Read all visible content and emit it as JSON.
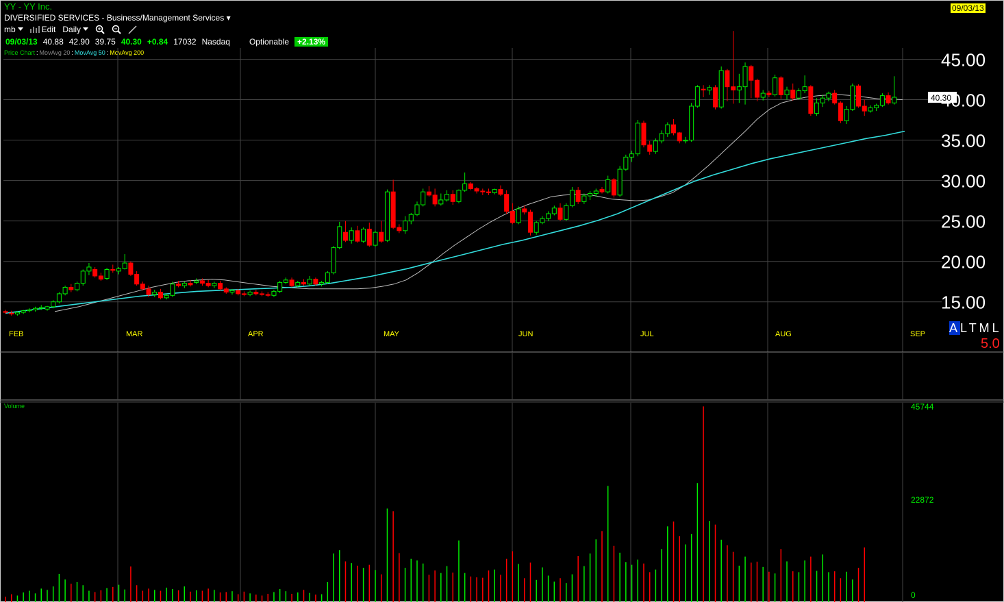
{
  "header": {
    "title": "YY - YY Inc.",
    "date_badge": "09/03/13",
    "sector": "DIVERSIFIED SERVICES - Business/Management Services",
    "sector_arrow": "▾",
    "toolbar": {
      "list": "mb",
      "edit": "Edit",
      "period": "Daily"
    }
  },
  "quote": {
    "date": "09/03/13",
    "open": "40.88",
    "high": "42.90",
    "low": "39.75",
    "close": "40.30",
    "change": "+0.84",
    "volume": "17032",
    "exchange": "Nasdaq",
    "optionable": "Optionable",
    "pct_change": "+2.13%"
  },
  "legend": {
    "price": "Price Chart",
    "ma20": "MovAvg 20",
    "ma50": "MovAvg 50",
    "ma200": "MovAvg 200",
    "sep": ":"
  },
  "colors": {
    "up": "#00ee00",
    "down": "#ff0000",
    "ma20": "#bbbbbb",
    "ma50": "#33dddd",
    "ma200": "#ffff00",
    "grid": "#444444"
  },
  "panel": {
    "altml": "ALTML",
    "five": "5.0"
  },
  "chart_data": [
    {
      "type": "candlestick",
      "title": "",
      "y_ticks": [
        "15.00",
        "20.00",
        "25.00",
        "30.00",
        "35.00",
        "40.00",
        "45.00"
      ],
      "ylim": [
        12.8,
        48.5
      ],
      "x_ticks": [
        "FEB",
        "MAR",
        "APR",
        "MAY",
        "JUN",
        "JUL",
        "AUG",
        "SEP"
      ],
      "last_price_label": "40.30",
      "candles": [
        [
          13.8,
          14.0,
          13.5,
          13.7
        ],
        [
          13.6,
          13.9,
          13.3,
          13.5
        ],
        [
          13.5,
          13.8,
          13.3,
          13.7
        ],
        [
          13.7,
          14.0,
          13.5,
          13.9
        ],
        [
          13.9,
          14.2,
          13.7,
          14.0
        ],
        [
          14.0,
          14.4,
          13.8,
          14.2
        ],
        [
          14.2,
          14.6,
          14.0,
          14.3
        ],
        [
          14.1,
          14.5,
          13.9,
          14.4
        ],
        [
          14.4,
          15.2,
          14.2,
          15.0
        ],
        [
          15.0,
          16.2,
          14.8,
          16.0
        ],
        [
          16.0,
          17.0,
          15.8,
          16.8
        ],
        [
          16.8,
          17.2,
          16.2,
          16.5
        ],
        [
          16.5,
          17.5,
          16.3,
          17.3
        ],
        [
          17.3,
          19.0,
          17.0,
          18.8
        ],
        [
          18.8,
          19.8,
          18.3,
          19.3
        ],
        [
          19.0,
          19.3,
          18.0,
          18.2
        ],
        [
          18.2,
          18.6,
          17.6,
          17.8
        ],
        [
          17.9,
          19.2,
          17.7,
          19.0
        ],
        [
          19.0,
          19.6,
          18.6,
          18.9
        ],
        [
          18.8,
          19.3,
          18.4,
          19.1
        ],
        [
          19.1,
          20.9,
          19.0,
          19.8
        ],
        [
          19.8,
          20.0,
          18.2,
          18.4
        ],
        [
          18.4,
          18.8,
          17.0,
          17.2
        ],
        [
          17.2,
          17.5,
          16.4,
          16.6
        ],
        [
          16.6,
          17.0,
          15.6,
          15.9
        ],
        [
          15.9,
          16.5,
          15.6,
          16.2
        ],
        [
          16.2,
          16.6,
          15.3,
          15.5
        ],
        [
          15.5,
          16.0,
          15.3,
          15.8
        ],
        [
          15.8,
          17.5,
          15.6,
          17.2
        ],
        [
          17.2,
          17.6,
          16.8,
          17.0
        ],
        [
          17.0,
          17.5,
          16.7,
          17.3
        ],
        [
          17.3,
          17.7,
          16.9,
          17.1
        ],
        [
          17.4,
          17.9,
          17.2,
          17.6
        ],
        [
          17.6,
          17.9,
          17.0,
          17.3
        ],
        [
          17.3,
          17.7,
          16.8,
          17.0
        ],
        [
          17.0,
          17.5,
          16.7,
          17.3
        ],
        [
          17.3,
          17.6,
          16.4,
          16.6
        ],
        [
          16.6,
          16.8,
          16.0,
          16.2
        ],
        [
          16.2,
          16.6,
          15.9,
          16.4
        ],
        [
          16.4,
          16.6,
          15.8,
          16.0
        ],
        [
          16.0,
          16.3,
          15.7,
          15.9
        ],
        [
          15.9,
          16.4,
          15.7,
          16.2
        ],
        [
          16.2,
          16.5,
          15.8,
          16.0
        ],
        [
          16.0,
          16.3,
          15.7,
          15.9
        ],
        [
          15.9,
          16.2,
          15.6,
          15.8
        ],
        [
          15.8,
          16.5,
          15.6,
          16.3
        ],
        [
          16.3,
          17.6,
          16.1,
          17.4
        ],
        [
          17.4,
          18.0,
          17.2,
          17.7
        ],
        [
          17.7,
          18.0,
          16.8,
          17.0
        ],
        [
          17.0,
          17.6,
          16.8,
          17.4
        ],
        [
          17.4,
          17.8,
          17.0,
          17.2
        ],
        [
          17.2,
          18.2,
          17.0,
          17.8
        ],
        [
          17.8,
          18.0,
          17.0,
          17.2
        ],
        [
          17.2,
          17.6,
          16.9,
          17.4
        ],
        [
          17.4,
          18.8,
          17.2,
          18.6
        ],
        [
          18.6,
          21.9,
          18.4,
          21.7
        ],
        [
          21.7,
          24.9,
          21.5,
          24.3
        ],
        [
          23.6,
          25.0,
          22.4,
          22.6
        ],
        [
          22.6,
          24.2,
          22.2,
          23.8
        ],
        [
          23.8,
          24.4,
          22.3,
          22.5
        ],
        [
          22.5,
          24.2,
          22.3,
          24.0
        ],
        [
          24.0,
          24.8,
          21.8,
          22.0
        ],
        [
          22.0,
          23.8,
          21.8,
          23.6
        ],
        [
          23.6,
          25.0,
          22.3,
          22.5
        ],
        [
          22.6,
          28.9,
          22.4,
          28.6
        ],
        [
          28.6,
          30.1,
          24.0,
          24.2
        ],
        [
          24.2,
          24.6,
          23.5,
          23.8
        ],
        [
          23.8,
          25.6,
          23.4,
          25.0
        ],
        [
          25.0,
          26.0,
          24.6,
          25.8
        ],
        [
          25.8,
          27.4,
          25.6,
          27.0
        ],
        [
          27.0,
          29.0,
          26.8,
          28.6
        ],
        [
          28.6,
          29.3,
          28.0,
          28.2
        ],
        [
          28.2,
          29.0,
          26.8,
          27.1
        ],
        [
          27.1,
          28.4,
          26.9,
          27.6
        ],
        [
          27.6,
          28.8,
          27.4,
          28.3
        ],
        [
          28.3,
          28.8,
          27.0,
          27.4
        ],
        [
          27.4,
          28.9,
          27.2,
          28.8
        ],
        [
          28.8,
          31.0,
          28.6,
          29.6
        ],
        [
          29.6,
          29.8,
          28.8,
          29.0
        ],
        [
          29.0,
          29.2,
          28.4,
          28.7
        ],
        [
          28.7,
          29.0,
          28.2,
          28.6
        ],
        [
          28.6,
          29.0,
          28.2,
          28.5
        ],
        [
          28.5,
          29.0,
          28.3,
          28.9
        ],
        [
          28.9,
          29.4,
          28.1,
          28.3
        ],
        [
          28.3,
          28.8,
          25.9,
          26.2
        ],
        [
          26.2,
          27.2,
          24.6,
          24.8
        ],
        [
          24.8,
          26.8,
          24.6,
          26.5
        ],
        [
          26.5,
          26.9,
          25.8,
          26.1
        ],
        [
          26.1,
          26.4,
          23.2,
          23.6
        ],
        [
          23.6,
          25.0,
          23.3,
          24.8
        ],
        [
          24.8,
          25.6,
          24.6,
          25.3
        ],
        [
          25.3,
          26.2,
          25.0,
          25.9
        ],
        [
          25.9,
          26.9,
          25.7,
          26.6
        ],
        [
          26.6,
          27.2,
          25.0,
          25.2
        ],
        [
          25.2,
          27.2,
          25.0,
          26.9
        ],
        [
          26.9,
          29.2,
          26.7,
          28.8
        ],
        [
          28.8,
          29.2,
          27.1,
          27.4
        ],
        [
          27.4,
          28.4,
          27.1,
          28.1
        ],
        [
          28.1,
          28.7,
          27.6,
          28.4
        ],
        [
          28.4,
          29.0,
          28.0,
          28.7
        ],
        [
          28.9,
          29.2,
          28.4,
          28.6
        ],
        [
          28.6,
          30.6,
          28.4,
          30.1
        ],
        [
          30.1,
          30.3,
          27.9,
          28.2
        ],
        [
          28.2,
          31.8,
          28.0,
          31.4
        ],
        [
          31.4,
          33.2,
          31.2,
          32.9
        ],
        [
          32.9,
          33.7,
          32.3,
          33.3
        ],
        [
          33.3,
          37.5,
          33.0,
          37.1
        ],
        [
          37.1,
          37.4,
          34.1,
          34.4
        ],
        [
          34.4,
          34.9,
          33.2,
          33.6
        ],
        [
          33.6,
          35.2,
          33.3,
          34.9
        ],
        [
          34.9,
          36.2,
          34.6,
          35.8
        ],
        [
          35.8,
          37.2,
          35.4,
          36.9
        ],
        [
          36.9,
          37.6,
          35.6,
          35.9
        ],
        [
          35.9,
          36.0,
          34.6,
          34.9
        ],
        [
          34.9,
          35.4,
          34.6,
          35.0
        ],
        [
          35.0,
          39.6,
          34.8,
          39.2
        ],
        [
          39.2,
          41.8,
          39.0,
          41.6
        ],
        [
          41.3,
          41.8,
          40.3,
          41.2
        ],
        [
          41.2,
          41.8,
          40.6,
          41.5
        ],
        [
          41.5,
          41.8,
          38.8,
          39.1
        ],
        [
          39.1,
          44.1,
          38.9,
          43.6
        ],
        [
          43.6,
          43.8,
          39.8,
          41.6
        ],
        [
          41.6,
          48.5,
          39.5,
          41.2
        ],
        [
          41.2,
          43.2,
          39.6,
          41.6
        ],
        [
          41.6,
          44.6,
          39.4,
          44.1
        ],
        [
          44.1,
          44.3,
          40.2,
          42.4
        ],
        [
          42.4,
          42.6,
          39.8,
          40.3
        ],
        [
          40.3,
          41.2,
          39.9,
          40.8
        ],
        [
          40.8,
          41.1,
          40.3,
          40.6
        ],
        [
          40.6,
          43.1,
          40.4,
          42.7
        ],
        [
          42.7,
          42.9,
          40.1,
          40.6
        ],
        [
          40.6,
          41.6,
          40.0,
          41.2
        ],
        [
          41.2,
          42.0,
          39.9,
          40.2
        ],
        [
          40.2,
          41.4,
          40.0,
          41.1
        ],
        [
          41.1,
          43.0,
          40.8,
          41.6
        ],
        [
          41.6,
          41.8,
          38.0,
          38.3
        ],
        [
          38.3,
          40.2,
          38.0,
          39.6
        ],
        [
          39.6,
          40.6,
          39.1,
          40.2
        ],
        [
          40.2,
          41.0,
          39.8,
          40.8
        ],
        [
          40.8,
          41.2,
          39.4,
          39.6
        ],
        [
          39.6,
          39.8,
          37.1,
          37.4
        ],
        [
          37.4,
          39.2,
          37.0,
          38.8
        ],
        [
          38.8,
          42.0,
          38.6,
          41.7
        ],
        [
          41.7,
          41.9,
          39.0,
          39.2
        ],
        [
          39.2,
          40.0,
          38.0,
          38.6
        ],
        [
          38.6,
          39.3,
          38.4,
          39.0
        ],
        [
          39.0,
          39.5,
          38.6,
          39.3
        ],
        [
          39.3,
          40.8,
          39.1,
          40.5
        ],
        [
          40.5,
          40.9,
          39.4,
          39.6
        ],
        [
          39.6,
          42.9,
          39.4,
          40.3
        ]
      ],
      "series": [
        {
          "name": "MovAvg 20",
          "values": [
            13.8,
            14.1,
            14.4,
            14.8,
            15.2,
            15.6,
            16.0,
            16.4,
            16.8,
            17.1,
            17.4,
            17.6,
            17.7,
            17.8,
            17.7,
            17.5,
            17.3,
            17.1,
            16.9,
            16.8,
            16.7,
            16.6,
            16.6,
            16.6,
            16.6,
            16.6,
            16.7,
            16.9,
            17.2,
            17.7,
            18.6,
            19.7,
            20.9,
            22.0,
            23.0,
            24.0,
            24.9,
            25.7,
            26.4,
            27.0,
            27.5,
            28.0,
            28.2,
            28.3,
            28.3,
            28.0,
            27.7,
            27.6,
            27.5,
            27.6,
            28.0,
            28.5,
            29.4,
            30.6,
            31.9,
            33.3,
            34.7,
            36.1,
            37.6,
            38.8,
            39.6,
            40.0,
            40.3,
            40.5,
            40.6,
            40.6,
            40.5,
            40.3,
            40.1,
            40.1,
            40.0
          ]
        },
        {
          "name": "MovAvg 50",
          "values": [
            13.6,
            13.9,
            14.2,
            14.5,
            14.8,
            15.1,
            15.4,
            15.7,
            15.9,
            16.1,
            16.3,
            16.4,
            16.5,
            16.6,
            16.7,
            16.8,
            17.0,
            17.3,
            17.7,
            18.1,
            18.6,
            19.1,
            19.7,
            20.3,
            20.9,
            21.5,
            22.1,
            22.6,
            23.2,
            23.8,
            24.4,
            25.1,
            25.9,
            26.9,
            27.9,
            28.9,
            29.9,
            30.7,
            31.4,
            32.1,
            32.7,
            33.2,
            33.7,
            34.2,
            34.7,
            35.2,
            35.6,
            36.1
          ]
        }
      ]
    },
    {
      "type": "bar",
      "title": "Volume",
      "y_ticks": [
        "0",
        "22872",
        "45744"
      ],
      "ylim": [
        0,
        45744
      ],
      "values": [
        1200,
        1800,
        1500,
        2200,
        2600,
        2000,
        3100,
        2800,
        3600,
        6500,
        5200,
        4200,
        4600,
        3900,
        2600,
        2300,
        2700,
        3200,
        3500,
        4000,
        2900,
        8200,
        3900,
        2600,
        3100,
        2800,
        2600,
        3300,
        3000,
        2700,
        3600,
        2400,
        2700,
        2600,
        3100,
        2800,
        2200,
        2300,
        2500,
        1800,
        2400,
        2000,
        1700,
        1500,
        1900,
        2300,
        3000,
        2500,
        1900,
        2200,
        2800,
        2100,
        1700,
        1800,
        4600,
        11200,
        12000,
        9400,
        9000,
        8400,
        7900,
        8600,
        7400,
        6400,
        21600,
        21000,
        11300,
        7900,
        10000,
        9600,
        8900,
        6300,
        7300,
        6700,
        8300,
        6800,
        14200,
        6700,
        5900,
        5700,
        5600,
        7300,
        7500,
        6300,
        10000,
        11700,
        8800,
        5500,
        9100,
        5100,
        8000,
        6100,
        4700,
        5500,
        4400,
        6400,
        10600,
        8300,
        11200,
        14500,
        16400,
        26800,
        13000,
        11400,
        9200,
        8600,
        9800,
        8900,
        6900,
        7500,
        12200,
        17500,
        18600,
        15200,
        13300,
        15700,
        27500,
        45200,
        18700,
        17900,
        14400,
        13100,
        11600,
        8400,
        10500,
        9100,
        9300,
        8100,
        7000,
        6600,
        12200,
        9400,
        7100,
        6900,
        9600,
        10500,
        7200,
        11000,
        6900,
        7100,
        5500,
        7000,
        5200,
        7900,
        12600
      ]
    }
  ]
}
